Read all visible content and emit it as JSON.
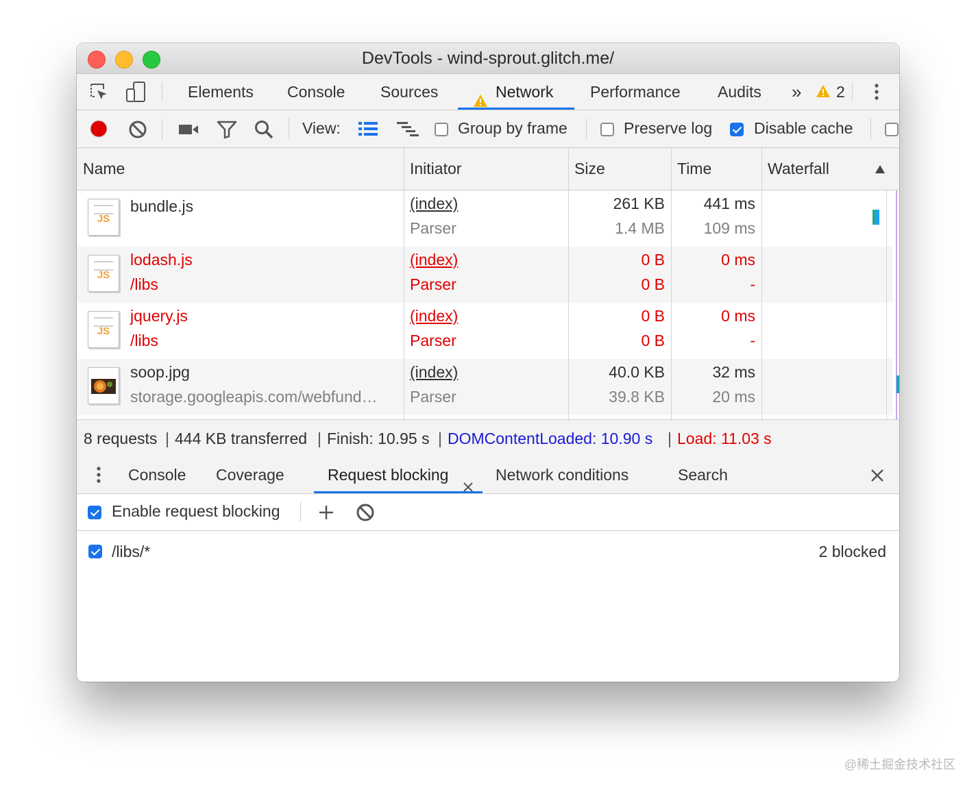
{
  "window": {
    "title": "DevTools - wind-sprout.glitch.me/"
  },
  "main_tabs": [
    {
      "label": "Elements",
      "active": false
    },
    {
      "label": "Console",
      "active": false
    },
    {
      "label": "Sources",
      "active": false
    },
    {
      "label": "Network",
      "active": true
    },
    {
      "label": "Performance",
      "active": false
    },
    {
      "label": "Audits",
      "active": false
    }
  ],
  "warnings": {
    "count": "2"
  },
  "toolbar": {
    "view_label": "View:",
    "group_by_frame": {
      "label": "Group by frame",
      "checked": false
    },
    "preserve_log": {
      "label": "Preserve log",
      "checked": false
    },
    "disable_cache": {
      "label": "Disable cache",
      "checked": true
    }
  },
  "grid": {
    "columns": [
      "Name",
      "Initiator",
      "Size",
      "Time",
      "Waterfall"
    ],
    "rows": [
      {
        "name": "bundle.js",
        "path": "",
        "icon": "js-file-icon",
        "initiator": "(index)",
        "initiator_type": "Parser",
        "size": "261 KB",
        "resource_size": "1.4 MB",
        "time": "441 ms",
        "latency": "109 ms",
        "blocked": false
      },
      {
        "name": "lodash.js",
        "path": "/libs",
        "icon": "js-file-icon",
        "initiator": "(index)",
        "initiator_type": "Parser",
        "size": "0 B",
        "resource_size": "0 B",
        "time": "0 ms",
        "latency": "-",
        "blocked": true
      },
      {
        "name": "jquery.js",
        "path": "/libs",
        "icon": "js-file-icon",
        "initiator": "(index)",
        "initiator_type": "Parser",
        "size": "0 B",
        "resource_size": "0 B",
        "time": "0 ms",
        "latency": "-",
        "blocked": true
      },
      {
        "name": "soop.jpg",
        "path": "storage.googleapis.com/webfund…",
        "icon": "image-thumbnail-icon",
        "initiator": "(index)",
        "initiator_type": "Parser",
        "size": "40.0 KB",
        "resource_size": "39.8 KB",
        "time": "32 ms",
        "latency": "20 ms",
        "blocked": false
      }
    ]
  },
  "summary": {
    "requests": "8 requests",
    "transferred": "444 KB transferred",
    "finish": "Finish: 10.95 s",
    "dom_content_loaded": "DOMContentLoaded: 10.90 s",
    "load": "Load: 11.03 s",
    "divider": "|"
  },
  "drawer": {
    "tabs": [
      {
        "label": "Console",
        "active": false
      },
      {
        "label": "Coverage",
        "active": false
      },
      {
        "label": "Request blocking",
        "active": true
      },
      {
        "label": "Network conditions",
        "active": false
      },
      {
        "label": "Search",
        "active": false
      }
    ],
    "enable_blocking": {
      "label": "Enable request blocking",
      "checked": true
    },
    "patterns": [
      {
        "pattern": "/libs/*",
        "checked": true,
        "count": "2 blocked"
      }
    ]
  },
  "watermark": "@稀土掘金技术社区",
  "colors": {
    "accent": "#1a73e8",
    "blocked": "#e00000",
    "dcl": "#1a1ad6",
    "load": "#e00000",
    "record": "#e00000"
  }
}
